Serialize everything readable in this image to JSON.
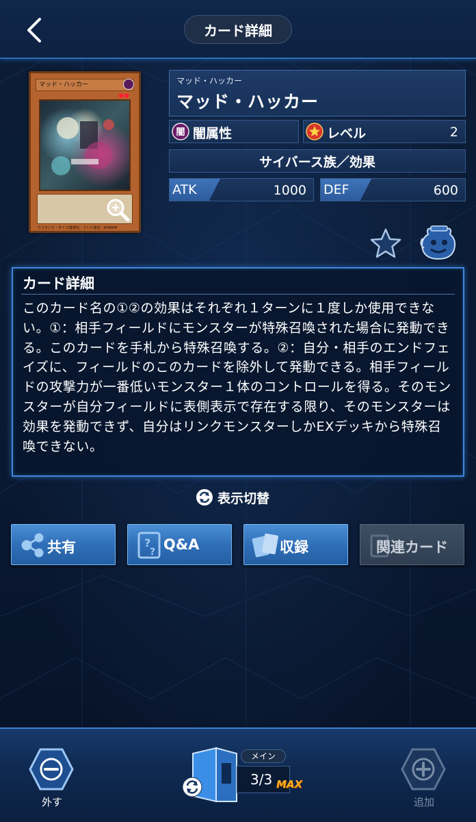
{
  "header": {
    "title": "カード詳細"
  },
  "card": {
    "thumb_name": "マッド・ハッカー",
    "thumb_attribute": "闇",
    "thumb_footer": "©スタジオ・ダイス/集英社・テレビ東京・KONAMI"
  },
  "info": {
    "ruby": "マッド・ハッカー",
    "name": "マッド・ハッカー",
    "attribute_label": "闇属性",
    "attribute_icon_char": "闇",
    "level_label": "レベル",
    "level_value": "2",
    "race_type": "サイバース族／効果",
    "atk_label": "ATK",
    "atk_value": "1000",
    "def_label": "DEF",
    "def_value": "600"
  },
  "detail": {
    "title": "カード詳細",
    "text": "このカード名の①②の効果はそれぞれ１ターンに１度しか使用できない。①：相手フィールドにモンスターが特殊召喚された場合に発動できる。このカードを手札から特殊召喚する。②：自分・相手のエンドフェイズに、フィールドのこのカードを除外して発動できる。相手フィールドの攻撃力が一番低いモンスター１体のコントロールを得る。そのモンスターが自分フィールドに表側表示で存在する限り、そのモンスターは効果を発動できず、自分はリンクモンスターしかEXデッキから特殊召喚できない。"
  },
  "toggle_label": "表示切替",
  "actions": {
    "share": "共有",
    "qa": "Q&A",
    "record": "収録",
    "related": "関連カード"
  },
  "footer": {
    "remove_label": "外す",
    "add_label": "追加",
    "deck_tag": "メイン",
    "deck_count": "3/3",
    "max_badge": "MAX"
  },
  "colors": {
    "accent": "#3f86d8",
    "button_blue": "#2f6fb8",
    "background": "#0a1a33",
    "max_orange": "#ffb020"
  },
  "icons": {
    "back": "chevron-left-icon",
    "zoom": "magnifier-plus-icon",
    "attribute": "dark-attribute-icon",
    "level": "level-star-icon",
    "favorite": "star-outline-icon",
    "pot": "pot-of-greed-icon",
    "toggle": "rotate-icon",
    "share": "share-icon",
    "qa": "qa-icon",
    "record": "cards-icon",
    "related": "related-cards-icon",
    "remove": "minus-hex-icon",
    "add": "plus-hex-icon",
    "deck": "deck-box-icon"
  }
}
